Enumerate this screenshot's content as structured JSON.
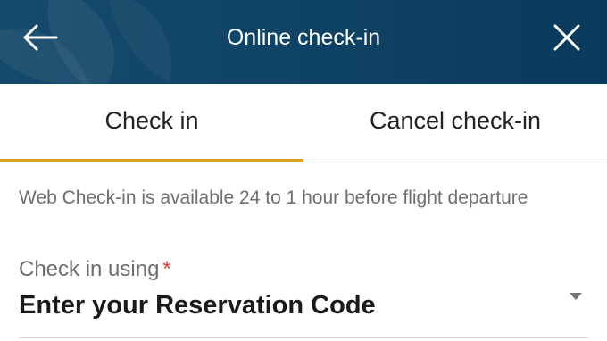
{
  "header": {
    "title": "Online check-in",
    "back_icon": "arrow-left-icon",
    "close_icon": "close-icon",
    "background_color": "#0f4466"
  },
  "tabs": [
    {
      "label": "Check in",
      "active": true
    },
    {
      "label": "Cancel check-in",
      "active": false
    }
  ],
  "accent_color": "#dca421",
  "info_text": "Web Check-in is available 24 to 1 hour before flight departure",
  "checkin_field": {
    "label": "Check in using",
    "required_marker": "*",
    "value": "Enter your Reservation Code",
    "dropdown_icon": "caret-down-icon"
  }
}
